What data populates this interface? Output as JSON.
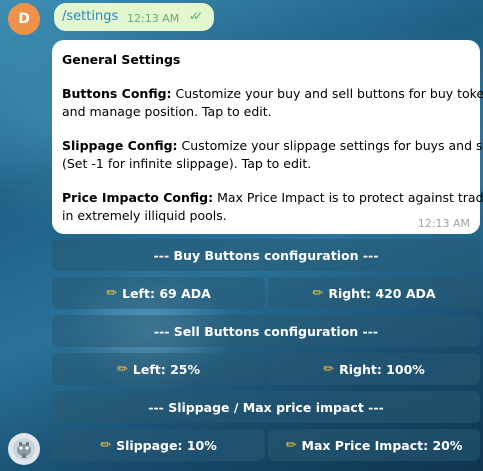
{
  "top_avatar": {
    "initial": "D",
    "color": "#f0914a"
  },
  "outgoing": {
    "text": "/settings",
    "time": "12:13 AM",
    "status_icon": "double-check-icon"
  },
  "incoming": {
    "title": "General Settings",
    "buttons_label": "Buttons Config:",
    "buttons_text_1": " Customize your buy and sell buttons for buy token",
    "buttons_text_2": "and manage position. Tap to edit.",
    "slippage_label": "Slippage Config:",
    "slippage_text_1": " Customize your slippage settings for buys and sells",
    "slippage_text_2": "(Set -1 for infinite slippage). Tap to edit.",
    "price_label": "Price Impacto Config:",
    "price_text_1": " Max Price Impact is to protect against trades",
    "price_text_2": "in extremely illiquid pools.",
    "time": "12:13 AM"
  },
  "keyboard": {
    "buy_header": "--- Buy Buttons configuration ---",
    "buy_left": "Left: 69 ADA",
    "buy_right": "Right: 420 ADA",
    "sell_header": "--- Sell Buttons configuration ---",
    "sell_left": "Left: 25%",
    "sell_right": "Right: 100%",
    "slippage_header": "--- Slippage / Max price impact ---",
    "slippage": "Slippage: 10%",
    "max_impact": "Max Price Impact: 20%",
    "pencil_icon": "pencil-icon"
  },
  "colors": {
    "bubble_out": "#e2f7cf",
    "bubble_in": "#ffffff",
    "link": "#2e86c1",
    "accent_pencil": "#f5c542"
  }
}
